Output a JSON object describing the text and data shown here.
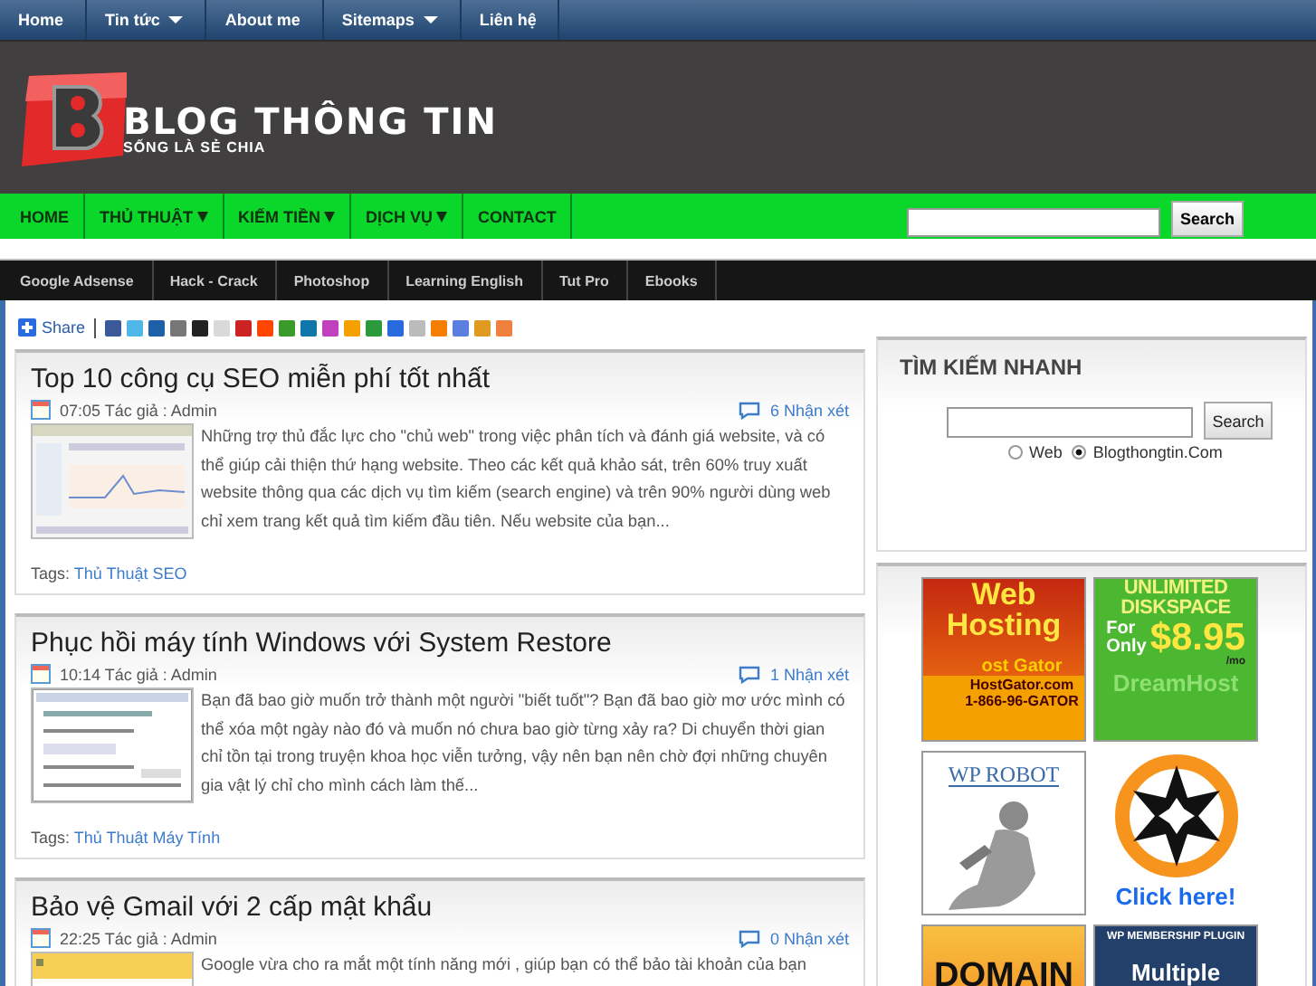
{
  "top_menu": [
    {
      "label": "Home",
      "dropdown": false
    },
    {
      "label": "Tin tức",
      "dropdown": true
    },
    {
      "label": "About me",
      "dropdown": false
    },
    {
      "label": "Sitemaps",
      "dropdown": true
    },
    {
      "label": "Liên hệ",
      "dropdown": false
    }
  ],
  "logo": {
    "title": "BLOG THÔNG TIN",
    "tagline": "SỐNG LÀ SẺ CHIA"
  },
  "main_nav": [
    {
      "label": "HOME",
      "dropdown": false
    },
    {
      "label": "THỦ THUẬT",
      "dropdown": true
    },
    {
      "label": "KIẾM TIỀN",
      "dropdown": true
    },
    {
      "label": "DỊCH VỤ",
      "dropdown": true
    },
    {
      "label": "CONTACT",
      "dropdown": false
    }
  ],
  "header_search": {
    "button": "Search"
  },
  "sub_nav": [
    "Google Adsense",
    "Hack - Crack",
    "Photoshop",
    "Learning English",
    "Tut Pro",
    "Ebooks"
  ],
  "share": {
    "label": "Share"
  },
  "posts": [
    {
      "title": "Top 10 công cụ SEO miễn phí tốt nhất",
      "time": "07:05",
      "author": "Tác giả : Admin",
      "comments": "6 Nhận xét",
      "excerpt": "Những trợ thủ đắc lực cho \"chủ web\" trong việc phân tích và đánh giá website, và có thể giúp cải thiện thứ hạng website. Theo các kết quả khảo sát, trên 60% truy xuất website thông qua các dịch vụ tìm kiếm (search engine) và trên 90% người dùng web chỉ xem trang kết quả tìm kiếm đầu tiên. Nếu website của bạn...",
      "tags_label": "Tags:",
      "tag": "Thủ Thuật SEO"
    },
    {
      "title": "Phục hồi máy tính Windows với System Restore",
      "time": "10:14",
      "author": "Tác giả : Admin",
      "comments": "1 Nhận xét",
      "excerpt": "Bạn đã bao giờ muốn trở thành một người \"biết tuốt\"? Bạn đã bao giờ mơ ước mình có thể xóa một ngày nào đó và muốn nó chưa bao giờ từng xảy ra? Di chuyển thời gian chỉ tồn tại trong truyện khoa học viễn tưởng, vậy nên bạn nên chờ đợi những chuyên gia vật lý chỉ cho mình cách làm thế...",
      "tags_label": "Tags:",
      "tag": "Thủ Thuật Máy Tính"
    },
    {
      "title": "Bảo vệ Gmail với 2 cấp mật khẩu",
      "time": "22:25",
      "author": "Tác giả : Admin",
      "comments": "0 Nhận xét",
      "excerpt": "Google vừa cho ra mắt một tính năng mới , giúp bạn có thể bảo tài khoản của bạn"
    }
  ],
  "quick_search": {
    "title": "TÌM KIẾM NHANH",
    "button": "Search",
    "options": [
      {
        "label": "Web",
        "selected": false
      },
      {
        "label": "Blogthongtin.Com",
        "selected": true
      }
    ]
  },
  "ads": [
    {
      "kind": "hosting",
      "lines": [
        "Web",
        "Hosting",
        "ost Gator",
        "HostGator.com",
        "1-866-96-GATOR"
      ]
    },
    {
      "kind": "diskspace",
      "lines": [
        "UNLIMITED",
        "DISKSPACE",
        "For",
        "Only",
        "$8.95",
        "/mo",
        "DreamHost"
      ]
    },
    {
      "kind": "robot",
      "lines": [
        "WP ROBOT"
      ]
    },
    {
      "kind": "star",
      "lines": [
        "Click here!"
      ]
    },
    {
      "kind": "domain",
      "lines": [
        "DOMAIN"
      ]
    },
    {
      "kind": "membership",
      "lines": [
        "WP MEMBERSHIP PLUGIN",
        "Multiple"
      ]
    }
  ]
}
